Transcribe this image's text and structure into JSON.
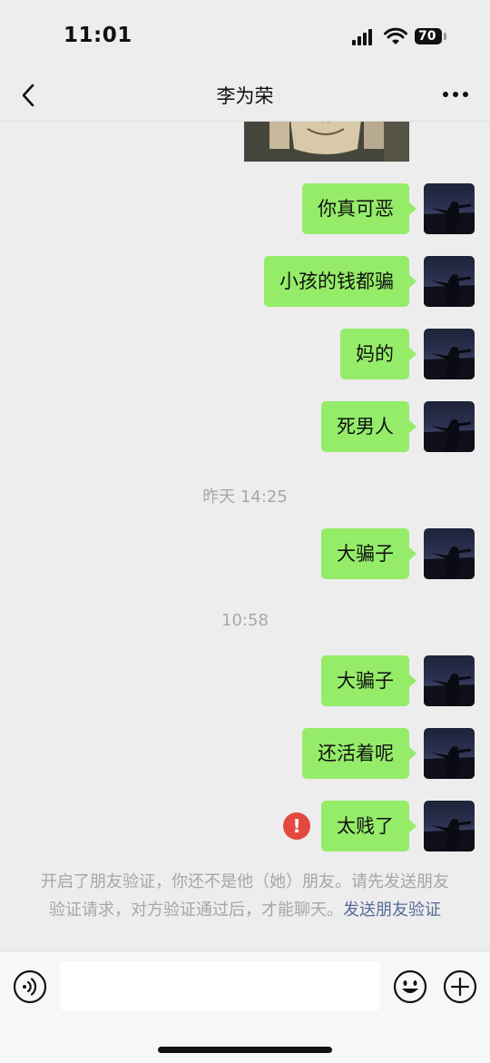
{
  "status_bar": {
    "time": "11:01",
    "battery": "70"
  },
  "header": {
    "title": "李为荣"
  },
  "messages": [
    {
      "text": "你真可恶"
    },
    {
      "text": "小孩的钱都骗"
    },
    {
      "text": "妈的"
    },
    {
      "text": "死男人"
    },
    {
      "timestamp": "昨天 14:25"
    },
    {
      "text": "大骗子"
    },
    {
      "timestamp": "10:58"
    },
    {
      "text": "大骗子"
    },
    {
      "text": "还活着呢"
    },
    {
      "text": "太贱了",
      "send_failed": true
    }
  ],
  "error_icon_glyph": "!",
  "system_notice": {
    "text": "开启了朋友验证，你还不是他（她）朋友。请先发送朋友验证请求，对方验证通过后，才能聊天。",
    "link_text": "发送朋友验证"
  },
  "colors": {
    "bubble": "#95ec69",
    "background": "#ededed",
    "link": "#576b95",
    "error": "#e5483e"
  },
  "icons": [
    "back-icon",
    "more-icon",
    "voice-icon",
    "emoji-icon",
    "plus-icon",
    "error-icon"
  ]
}
